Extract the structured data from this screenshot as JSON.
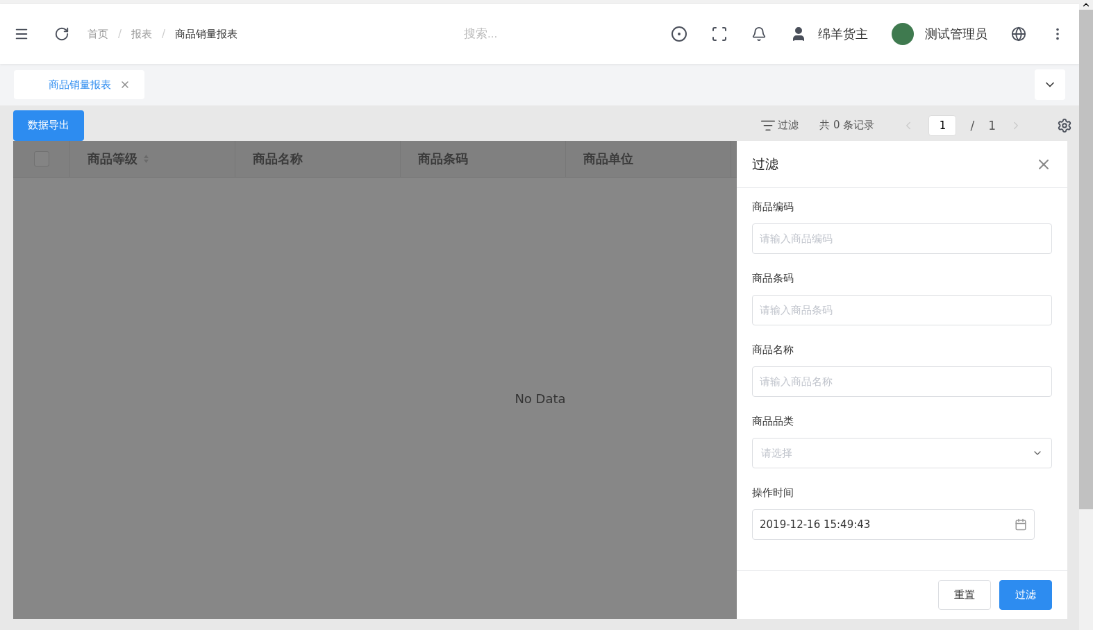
{
  "header": {
    "breadcrumb": [
      {
        "label": "首页",
        "current": false
      },
      {
        "label": "报表",
        "current": false,
        "separator": "/"
      },
      {
        "label": "商品销量报表",
        "current": true,
        "separator": "/"
      }
    ],
    "search": {
      "placeholder": "搜索..."
    },
    "shop": "绵羊货主",
    "user": "测试管理员"
  },
  "tabs": [
    {
      "label": "商品销量报表",
      "selected": true
    }
  ],
  "toolbar": {
    "export_button": "数据导出",
    "filter_link": "过滤",
    "total": "共 0 条记录",
    "page": "1",
    "page_sep": "/",
    "page_count": "1"
  },
  "table": {
    "columns": [
      {
        "label": "商品等级",
        "sortable": true
      },
      {
        "label": "商品名称",
        "sortable": false
      },
      {
        "label": "商品条码",
        "sortable": false
      },
      {
        "label": "商品单位",
        "sortable": false
      }
    ],
    "select_all_checked": false,
    "empty_text": "No Data"
  },
  "drawer": {
    "title": "过滤",
    "fields": [
      {
        "kind": "text",
        "label": "商品编码",
        "placeholder": "请输入商品编码"
      },
      {
        "kind": "text",
        "label": "商品条码",
        "placeholder": "请输入商品条码"
      },
      {
        "kind": "text",
        "label": "商品名称",
        "placeholder": "请输入商品名称"
      },
      {
        "kind": "select",
        "label": "商品品类",
        "placeholder": "请选择"
      },
      {
        "kind": "date",
        "label": "操作时间",
        "value": "2019-12-16 15:49:43"
      }
    ],
    "buttons": [
      {
        "label": "重置",
        "primary": false
      },
      {
        "label": "过滤",
        "primary": true
      }
    ]
  }
}
